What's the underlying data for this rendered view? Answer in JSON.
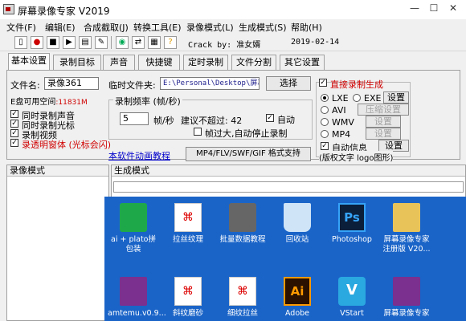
{
  "window": {
    "title": "屏幕录像专家 V2019",
    "minimize": "—",
    "maximize": "☐",
    "close": "✕"
  },
  "menu": [
    "文件(F)",
    "编辑(E)",
    "合成截取(J)",
    "转换工具(E)",
    "录像模式(L)",
    "生成模式(S)",
    "帮助(H)"
  ],
  "toolbar": {
    "crack": "Crack by: 准女婿",
    "date": "2019-02-14"
  },
  "tabs": [
    "基本设置",
    "录制目标",
    "声音",
    "快捷键",
    "定时录制",
    "文件分割",
    "其它设置"
  ],
  "basic": {
    "filename_label": "文件名:",
    "filename_value": "录像361",
    "temp_label": "临时文件夹:",
    "temp_value": "E:\\Personal\\Desktop\\屏幕",
    "browse": "选择",
    "space_label": "E盘可用空间",
    "space_value": ":11831M",
    "checks": [
      {
        "label": "同时录制声音",
        "checked": true,
        "red": false
      },
      {
        "label": "同时录制光标",
        "checked": true,
        "red": false
      },
      {
        "label": "录制视频",
        "checked": true,
        "red": false
      },
      {
        "label": "录透明窗体 (光标会闪)",
        "checked": true,
        "red": true
      }
    ],
    "fps_group": "录制频率 (帧/秒)",
    "fps_value": "5",
    "fps_unit": "帧/秒",
    "suggest": "建议不超过: 42",
    "auto": "自动",
    "auto_stop": "帧过大,自动停止录制",
    "tutorial": "本软件动画教程",
    "format_btn": "MP4/FLV/SWF/GIF 格式支持",
    "direct_gen": "直接录制生成",
    "formats": [
      {
        "label": "LXE",
        "selected": true
      },
      {
        "label": "EXE",
        "selected": false
      },
      {
        "label": "AVI",
        "selected": false
      },
      {
        "label": "WMV",
        "selected": false
      },
      {
        "label": "MP4",
        "selected": false
      }
    ],
    "settings_btn": "设置",
    "compress_btn": "压缩设置",
    "auto_info": "自动信息",
    "copyright": "(版权文字 logo图形)"
  },
  "panes": {
    "left_title": "录像模式",
    "right_title": "生成模式"
  },
  "desktop": {
    "row1": [
      "ai + plato拼包装",
      "拉丝纹理",
      "批量数据教程",
      "回收站",
      "Photoshop",
      "屏幕录像专家注册版 V20..."
    ],
    "row2": [
      "amtemu.v0.9...",
      "斜纹磨砂",
      "细纹拉丝",
      "Adobe",
      "VStart",
      "屏幕录像专家"
    ]
  }
}
